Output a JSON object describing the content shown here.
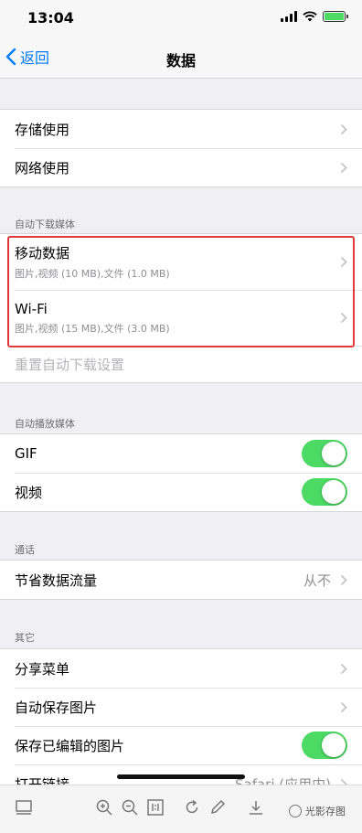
{
  "status": {
    "time": "13:04"
  },
  "nav": {
    "back": "返回",
    "title": "数据"
  },
  "usage": {
    "storage": "存储使用",
    "network": "网络使用"
  },
  "auto_download": {
    "header": "自动下载媒体",
    "mobile": {
      "label": "移动数据",
      "detail": "图片,视频 (10 MB),文件 (1.0 MB)"
    },
    "wifi": {
      "label": "Wi-Fi",
      "detail": "图片,视频 (15 MB),文件 (3.0 MB)"
    },
    "reset": "重置自动下载设置"
  },
  "autoplay": {
    "header": "自动播放媒体",
    "gif": {
      "label": "GIF",
      "on": true
    },
    "video": {
      "label": "视频",
      "on": true
    }
  },
  "calls": {
    "header": "通话",
    "save_data": {
      "label": "节省数据流量",
      "value": "从不"
    }
  },
  "other": {
    "header": "其它",
    "share_menu": "分享菜单",
    "auto_save": "自动保存图片",
    "save_edited": {
      "label": "保存已编辑的图片",
      "on": true
    },
    "open_links": {
      "label": "打开链接",
      "value": "Safari (应用内)"
    }
  },
  "watermark": {
    "text": "光影存图"
  },
  "colors": {
    "accent": "#007aff",
    "toggle_on": "#4cd964",
    "highlight": "#e03a3a"
  }
}
